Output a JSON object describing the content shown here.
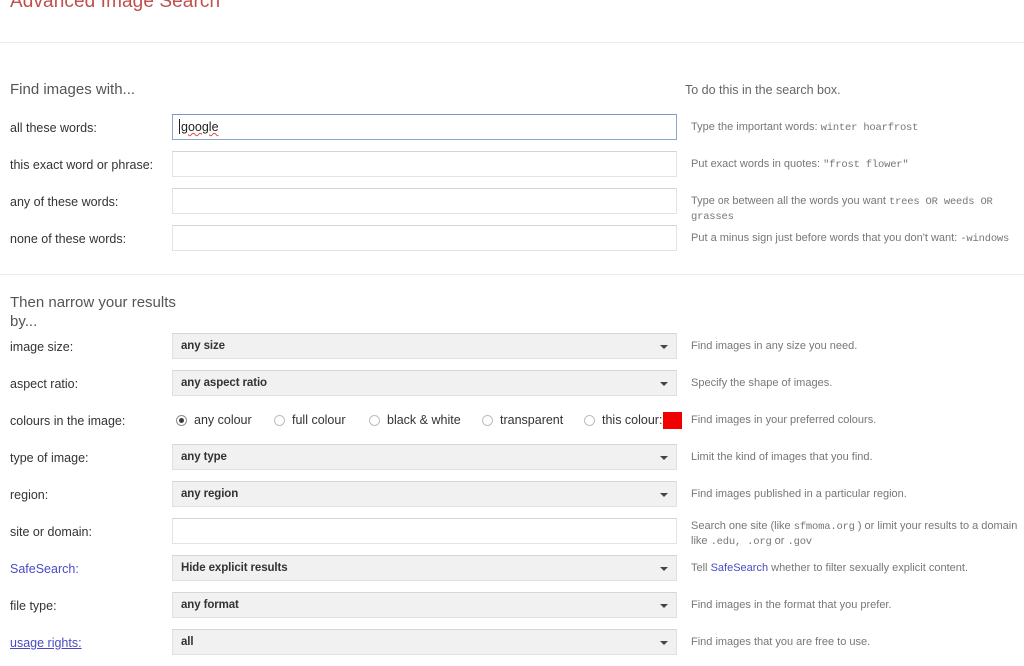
{
  "page": {
    "title": "Advanced Image Search"
  },
  "section1": {
    "heading_left": "Find images with...",
    "heading_right": "To do this in the search box.",
    "rows": [
      {
        "label": "all these words:",
        "field_type": "text",
        "value": "google",
        "focused": true,
        "help_prefix": "Type the important words:",
        "help_mono": "winter hoarfrost"
      },
      {
        "label": "this exact word or phrase:",
        "field_type": "text",
        "value": "",
        "focused": false,
        "help_prefix": "Put exact words in quotes:",
        "help_mono": "\"frost flower\""
      },
      {
        "label": "any of these words:",
        "field_type": "text",
        "value": "",
        "focused": false,
        "help_prefix": "Type",
        "help_or": "OR",
        "help_mid": "between all the words you want",
        "help_mono": "trees OR weeds OR grasses"
      },
      {
        "label": "none of these words:",
        "field_type": "text",
        "value": "",
        "focused": false,
        "help_prefix": "Put a minus sign just before words that you don't want:",
        "help_mono": "-windows"
      }
    ]
  },
  "section2": {
    "heading_left": "Then narrow your results by...",
    "rows": [
      {
        "label": "image size:",
        "field_type": "select",
        "value": "any size",
        "help": "Find images in any size you need."
      },
      {
        "label": "aspect ratio:",
        "field_type": "select",
        "value": "any aspect ratio",
        "help": "Specify the shape of images."
      },
      {
        "label": "colours in the image:",
        "field_type": "radios",
        "help": "Find images in your preferred colours.",
        "options": [
          {
            "label": "any colour",
            "checked": true
          },
          {
            "label": "full colour",
            "checked": false
          },
          {
            "label": "black & white",
            "checked": false
          },
          {
            "label": "transparent",
            "checked": false
          },
          {
            "label": "this colour:",
            "checked": false,
            "swatch": "#f10000"
          }
        ]
      },
      {
        "label": "type of image:",
        "field_type": "select",
        "value": "any type",
        "help": "Limit the kind of images that you find."
      },
      {
        "label": "region:",
        "field_type": "select",
        "value": "any region",
        "help": "Find images published in a particular region."
      },
      {
        "label": "site or domain:",
        "field_type": "text",
        "value": "",
        "help_part1": "Search one site (like",
        "help_mono1": "sfmoma.org",
        "help_part2": ") or limit your results to a domain like",
        "help_mono2": ".edu, .org",
        "help_part3": "or",
        "help_mono3": ".gov"
      },
      {
        "label": "SafeSearch:",
        "label_is_link": true,
        "field_type": "select",
        "value": "Hide explicit results",
        "help_part1": "Tell",
        "help_link": "SafeSearch",
        "help_part2": "whether to filter sexually explicit content."
      },
      {
        "label": "file type:",
        "field_type": "select",
        "value": "any format",
        "help": "Find images in the format that you prefer."
      },
      {
        "label": "usage rights:",
        "label_is_link": true,
        "label_underline": true,
        "field_type": "select",
        "value": "all",
        "help": "Find images that you are free to use."
      }
    ]
  },
  "colors": {
    "title": "#c0504d",
    "link": "#4a4ac4",
    "swatch": "#f10000",
    "select_bg": "#f1f1f1"
  }
}
